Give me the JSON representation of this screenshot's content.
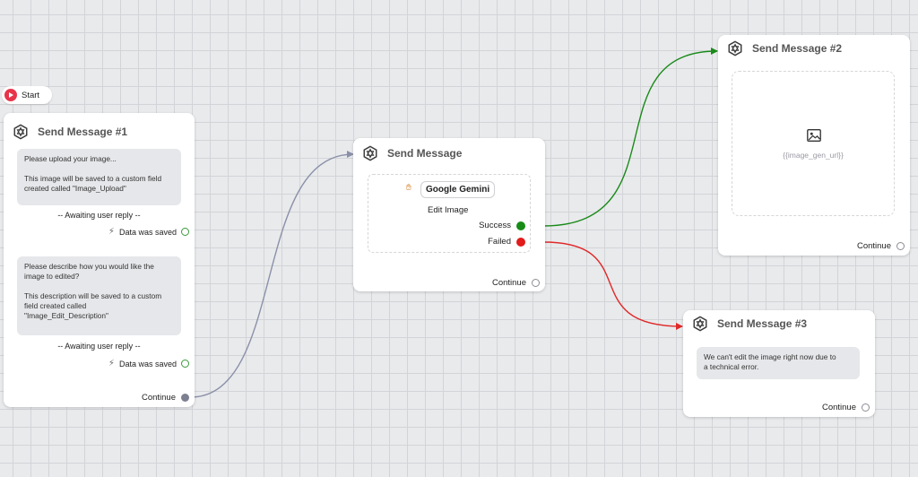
{
  "start": {
    "label": "Start"
  },
  "node1": {
    "title": "Send Message #1",
    "bubble1_lines": [
      "Please upload your image...",
      "",
      "This image will be saved to a custom field",
      "created called \"Image_Upload\""
    ],
    "awaiting1": "-- Awaiting user reply --",
    "saved1": "Data was saved",
    "bubble2_lines": [
      "Please describe how you would like the",
      "image to edited?",
      "",
      "This description will be saved to a custom",
      "field created called",
      "\"Image_Edit_Description\""
    ],
    "awaiting2": "-- Awaiting user reply --",
    "saved2": "Data was saved",
    "continue": "Continue"
  },
  "node2": {
    "title": "Send Message",
    "integration": "Google Gemini",
    "action": "Edit Image",
    "success": "Success",
    "failed": "Failed",
    "continue": "Continue"
  },
  "node3": {
    "title": "Send Message #2",
    "image_variable": "{{image_gen_url}}",
    "continue": "Continue"
  },
  "node4": {
    "title": "Send Message #3",
    "bubble_lines": [
      "We can't edit the image right now due to",
      "a technical error."
    ],
    "continue": "Continue"
  },
  "colors": {
    "success_edge": "#1a8a1a",
    "failed_edge": "#e02828",
    "default_edge": "#8a90a8"
  },
  "icons": [
    "start-play-icon",
    "node-hexagon-icon",
    "lightning-icon",
    "hand-icon",
    "image-icon"
  ]
}
